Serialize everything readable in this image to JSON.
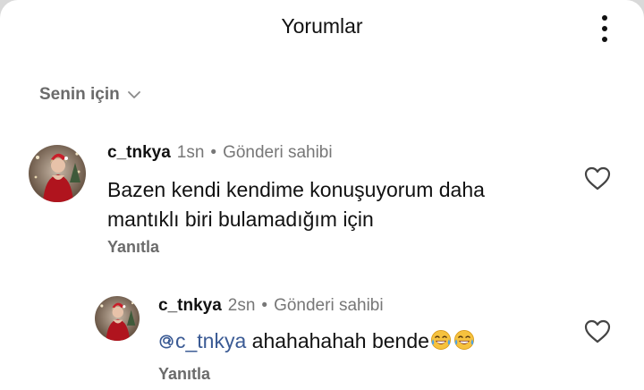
{
  "header": {
    "title": "Yorumlar",
    "more_icon": "more-vertical-icon"
  },
  "sort": {
    "label": "Senin için",
    "icon": "chevron-down-icon"
  },
  "comments": [
    {
      "username": "c_tnkya",
      "time": "1sn",
      "separator": "•",
      "badge": "Gönderi sahibi",
      "text_line1": "Bazen kendi kendime konuşuyorum daha",
      "text_line2": "mantıklı biri bulamadığım için",
      "reply_label": "Yanıtla",
      "like_icon": "heart-outline-icon"
    },
    {
      "username": "c_tnkya",
      "time": "2sn",
      "separator": "•",
      "badge": "Gönderi sahibi",
      "mention": "c_tnkya",
      "mention_icon": "threads-at-icon",
      "text": " ahahahahah bende",
      "emojis": [
        "face-with-tears-of-joy",
        "face-with-tears-of-joy"
      ],
      "reply_label": "Yanıtla",
      "like_icon": "heart-outline-icon"
    }
  ],
  "colors": {
    "text_primary": "#111111",
    "text_secondary": "#6b6b6b",
    "mention": "#3a5a94",
    "background": "#ffffff"
  }
}
